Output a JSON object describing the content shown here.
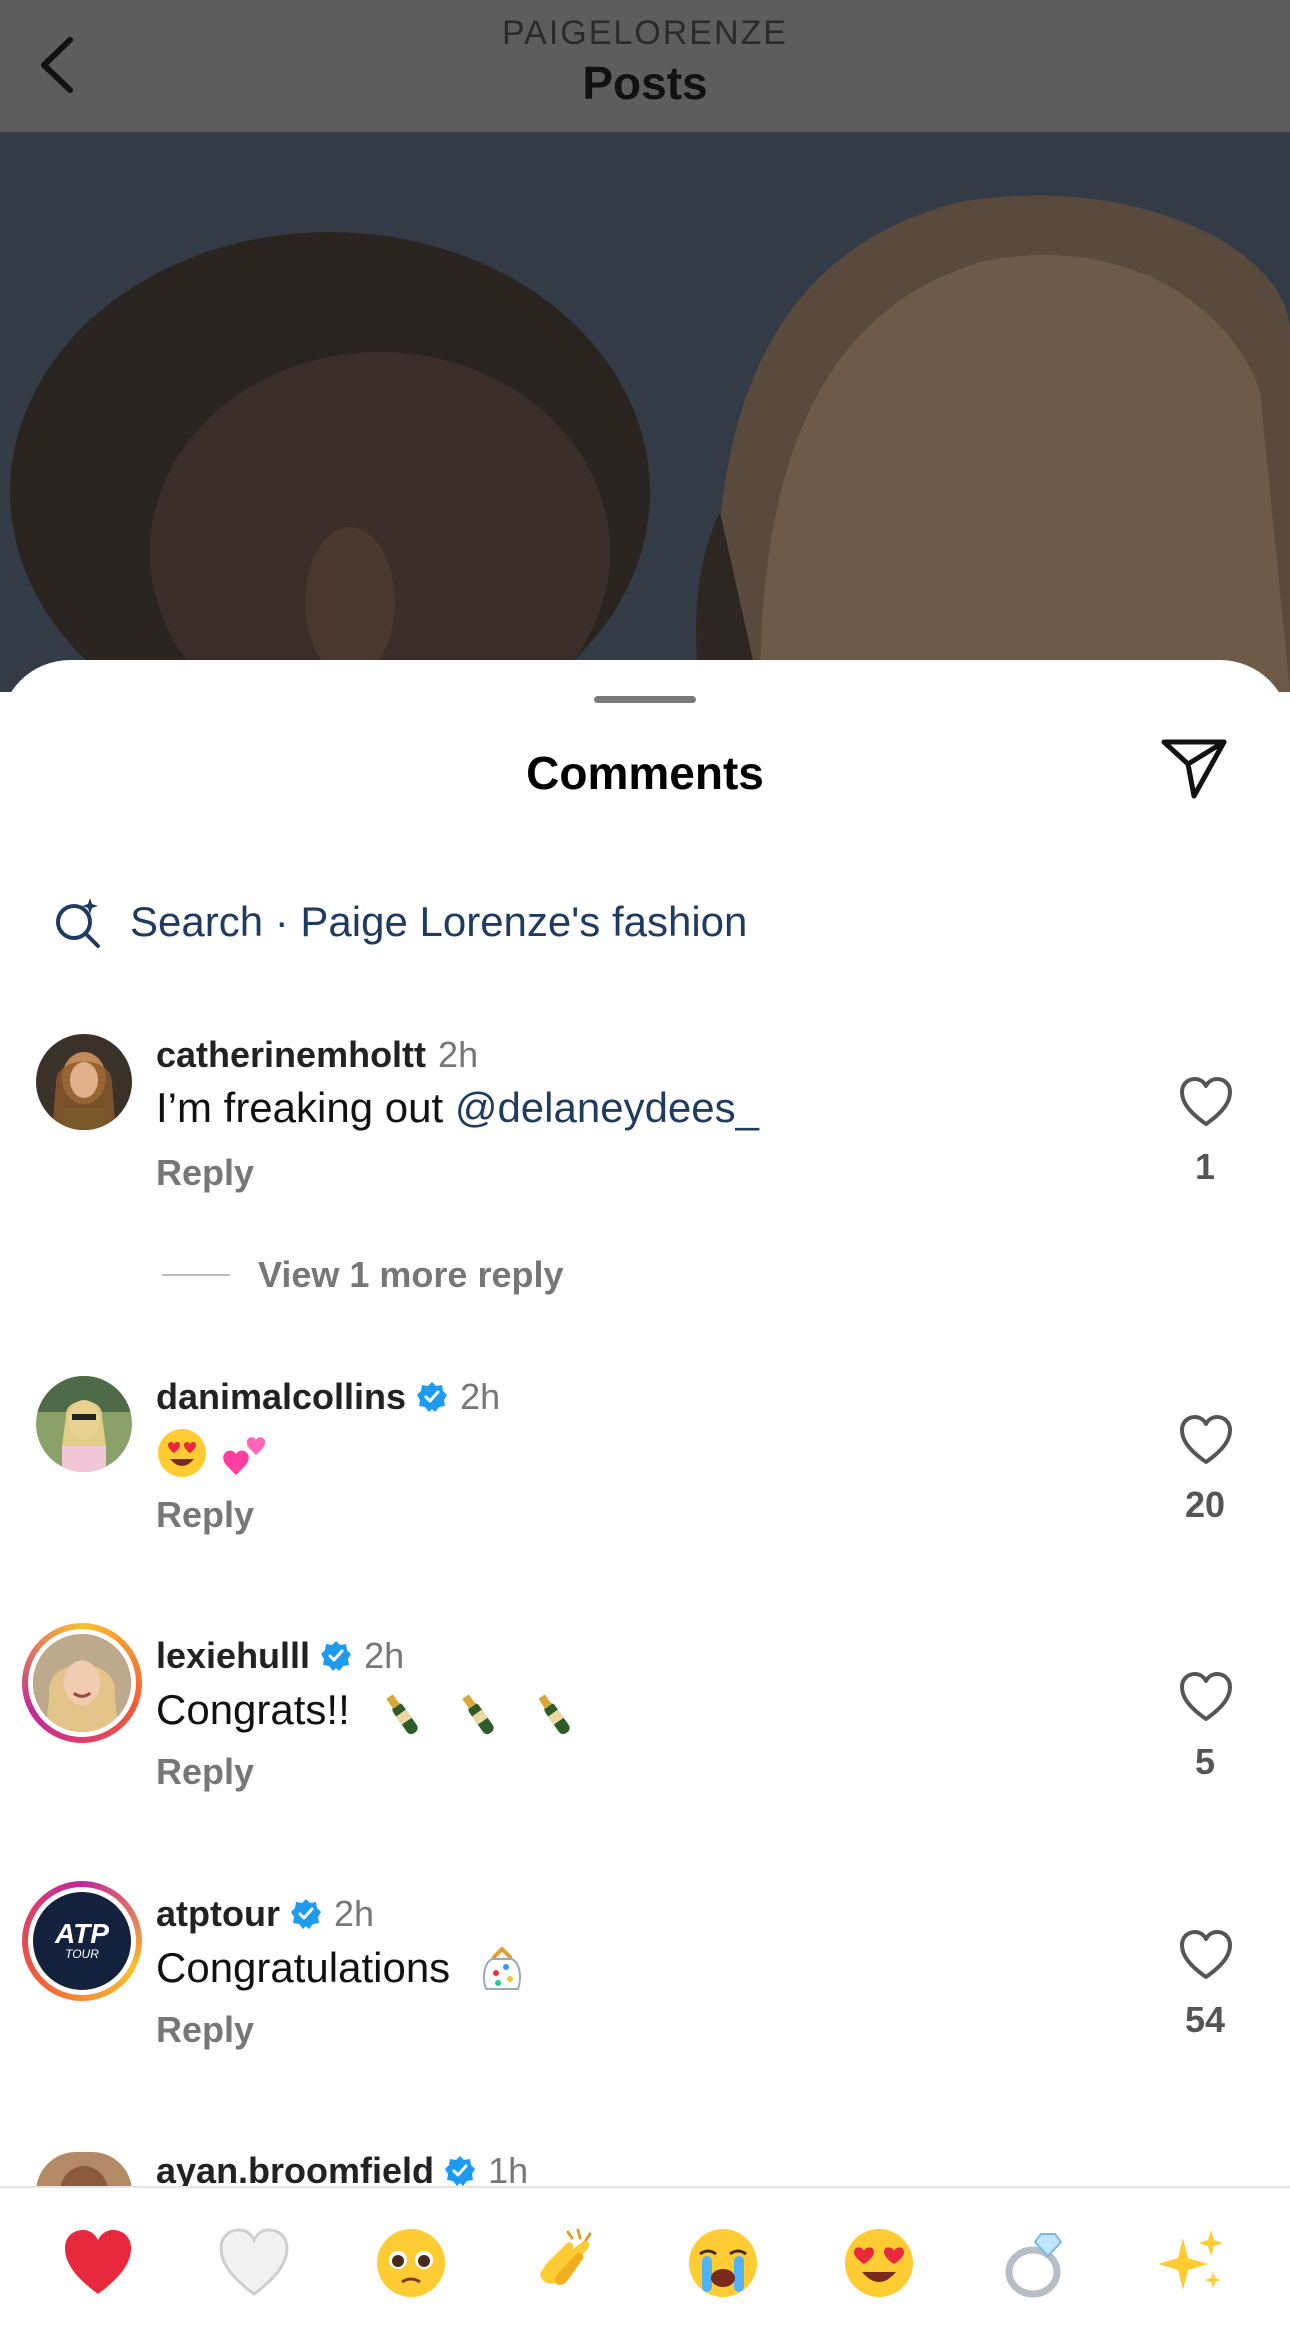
{
  "header": {
    "username": "PAIGELORENZE",
    "title": "Posts"
  },
  "sheet": {
    "title": "Comments"
  },
  "search": {
    "text": "Search · Paige Lorenze's fashion"
  },
  "comments": [
    {
      "username": "catherinemholtt",
      "verified": false,
      "time": "2h",
      "text": "I’m freaking out ",
      "mention": "@delaneydees_",
      "reply": "Reply",
      "likes": "1"
    },
    {
      "username": "danimalcollins",
      "verified": true,
      "time": "2h",
      "text": "",
      "emojis": [
        "heart-eyes-emoji",
        "two-hearts-emoji"
      ],
      "reply": "Reply",
      "likes": "20"
    },
    {
      "username": "lexiehulll",
      "verified": true,
      "time": "2h",
      "text": "Congrats!!",
      "emojis": [
        "champagne-emoji",
        "champagne-emoji",
        "champagne-emoji"
      ],
      "reply": "Reply",
      "likes": "5"
    },
    {
      "username": "atptour",
      "verified": true,
      "time": "2h",
      "text": "Congratulations",
      "emojis": [
        "confetti-emoji"
      ],
      "reply": "Reply",
      "likes": "54",
      "avatar_text": "ATP",
      "avatar_subtext": "TOUR"
    },
    {
      "username": "ayan.broomfield",
      "verified": true,
      "time": "1h"
    }
  ],
  "view_more_replies": "View 1 more reply",
  "emoji_bar": [
    "red-heart-emoji",
    "white-heart-emoji",
    "pleading-face-emoji",
    "clapping-hands-emoji",
    "crying-face-emoji",
    "heart-eyes-emoji",
    "ring-emoji",
    "sparkles-emoji"
  ],
  "colors": {
    "mention": "#1f3b5f",
    "verified": "#1d9bf0",
    "secondary_text": "#777777"
  }
}
